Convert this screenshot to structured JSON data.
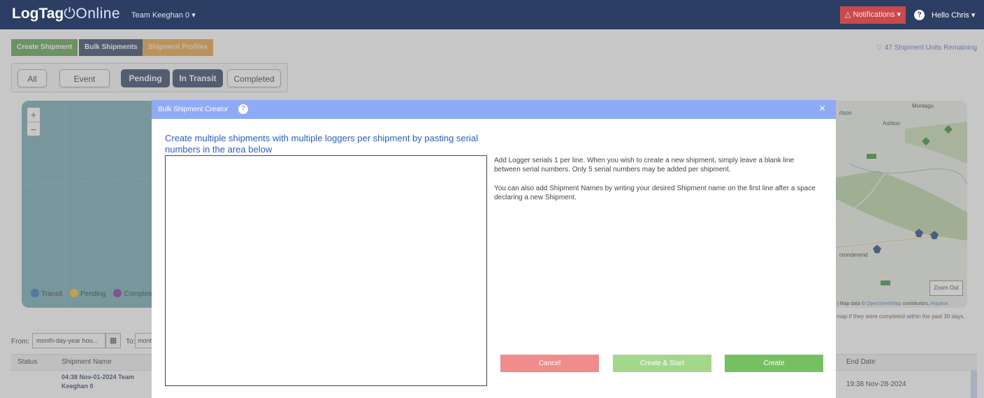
{
  "brand": {
    "name_bold": "LogTag",
    "name_light": "Online"
  },
  "header": {
    "team": "Team Keeghan 0 ▾",
    "notifications": "△ Notifications ▾",
    "help": "?",
    "user": "Hello Chris ▾"
  },
  "actions": {
    "create_shipment": "Create Shipment",
    "bulk_shipments": "Bulk Shipments",
    "shipment_profiles": "Shipment Profiles",
    "units_remaining": "♡ 47 Shipment Units Remaining"
  },
  "filters": [
    "All",
    "Event",
    "Pending",
    "In Transit",
    "Completed"
  ],
  "map": {
    "zoom_in": "+",
    "zoom_out_ctl": "−",
    "legend": [
      {
        "label": "Transit",
        "color": "#2c6fc4"
      },
      {
        "label": "Pending",
        "color": "#f2b926"
      },
      {
        "label": "Completed",
        "color": "#7b2fa0"
      }
    ],
    "zoom_out_button": "Zoom Out",
    "attribution_prefix": "| Map data ©",
    "attribution_link": "OpenStreetMap",
    "attribution_suffix": "contributors,",
    "attribution_mapbox": "Mapbox",
    "note": "map if they were completed within the past 30 days."
  },
  "dates": {
    "from_label": "From:",
    "from_placeholder": "month-day-year hou...",
    "calendar_icon": "▦",
    "to_label": "To:",
    "to_placeholder": "mont"
  },
  "table": {
    "columns": [
      "Status",
      "Shipment Name",
      "End Date"
    ],
    "rows": [
      {
        "name": "04:38 Nov-01-2024 Team Keeghan 0",
        "end": "19:38 Nov-28-2024"
      }
    ]
  },
  "modal": {
    "title": "Bulk Shipment Creator",
    "help": "?",
    "close": "×",
    "heading": "Create multiple shipments with multiple loggers per shipment by pasting serial numbers in the area below",
    "textarea_value": "",
    "info1": "Add Logger serials 1 per line. When you wish to create a new shipment, simply leave a blank line between serial numbers. Only 5 serial numbers may be added per shipment.",
    "info2": "You can also add Shipment Names by writing your desired Shipment name on the first line after a space declaring a new Shipment.",
    "buttons": {
      "cancel": "Cancel",
      "create_start": "Create & Start",
      "create": "Create"
    }
  },
  "colors": {
    "nav": "#2c3e63",
    "create_shipment": "#5a9e4a",
    "bulk_shipments": "#2c3e63",
    "shipment_profiles": "#e8a13d",
    "modal_header": "#8faaf7",
    "cancel": "#f08c8c",
    "create_start": "#a4d78c",
    "create": "#77c062"
  }
}
